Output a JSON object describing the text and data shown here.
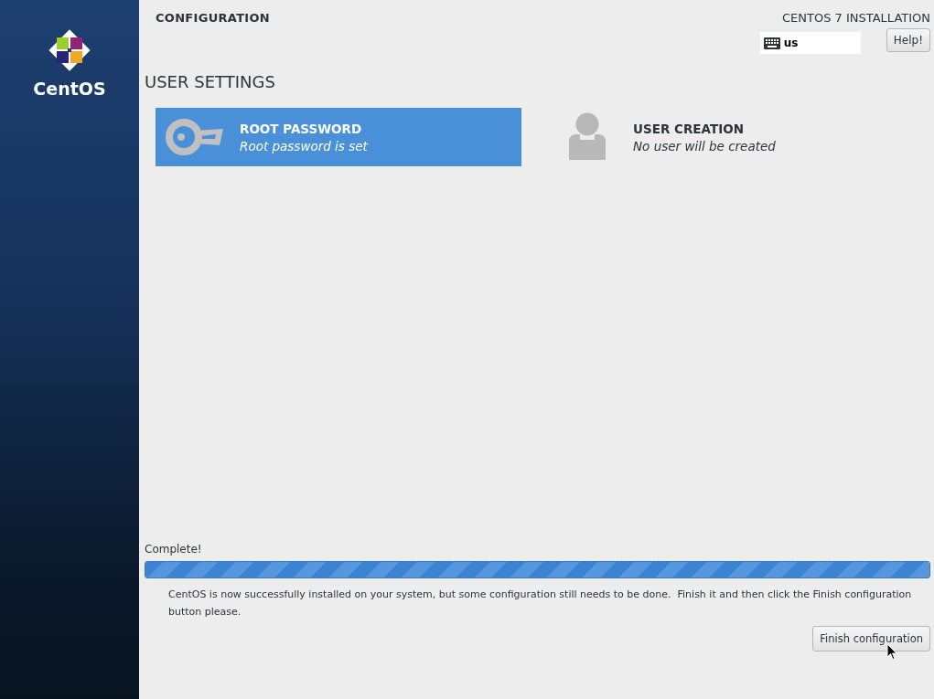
{
  "sidebar": {
    "logo_text": "CentOS"
  },
  "header": {
    "title": "CONFIGURATION",
    "product": "CENTOS 7 INSTALLATION",
    "keyboard_layout": "us",
    "help_button": "Help!"
  },
  "section": {
    "title": "USER SETTINGS",
    "spokes": [
      {
        "kind": "key",
        "title": "ROOT PASSWORD",
        "status": "Root password is set",
        "selected": true
      },
      {
        "kind": "user",
        "title": "USER CREATION",
        "status": "No user will be created",
        "selected": false
      }
    ]
  },
  "progress": {
    "label": "Complete!",
    "level": 1,
    "message": "CentOS is now successfully installed on your system, but some configuration still needs to be done.  Finish it and then click the Finish configuration button please.",
    "button": "Finish configuration"
  }
}
